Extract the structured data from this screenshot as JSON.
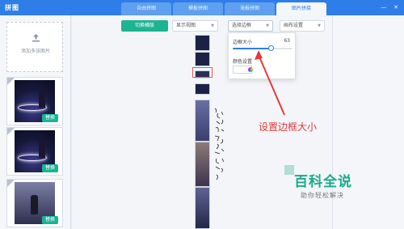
{
  "app": {
    "title": "拼图"
  },
  "tabs": [
    {
      "label": "自由拼图",
      "active": false
    },
    {
      "label": "模板拼图",
      "active": false
    },
    {
      "label": "海报拼图",
      "active": false
    },
    {
      "label": "图片拼接",
      "active": true
    }
  ],
  "window": {
    "min_glyph": "—",
    "close_glyph": "✕"
  },
  "left_panel": {
    "add_label": "添加多张图片",
    "thumbnails": [
      {
        "replace_label": "替换"
      },
      {
        "replace_label": "替换"
      },
      {
        "replace_label": "替换"
      }
    ]
  },
  "toolbar": {
    "switch_button": "切换横版",
    "display_view": "显示视图",
    "border_select": "选择边框",
    "canvas_settings": "画布设置"
  },
  "border_popup": {
    "size_label": "边框大小",
    "size_value": "63",
    "size_fraction": 0.63,
    "color_label": "颜色设置"
  },
  "annotation": {
    "text": "设置边框大小"
  },
  "watermark": {
    "title": "百科全说",
    "subtitle": "助你轻松解决"
  },
  "colors": {
    "titlebar": "#2f7de8",
    "accent_green": "#1cb491",
    "annotation_red": "#e33a3a"
  }
}
